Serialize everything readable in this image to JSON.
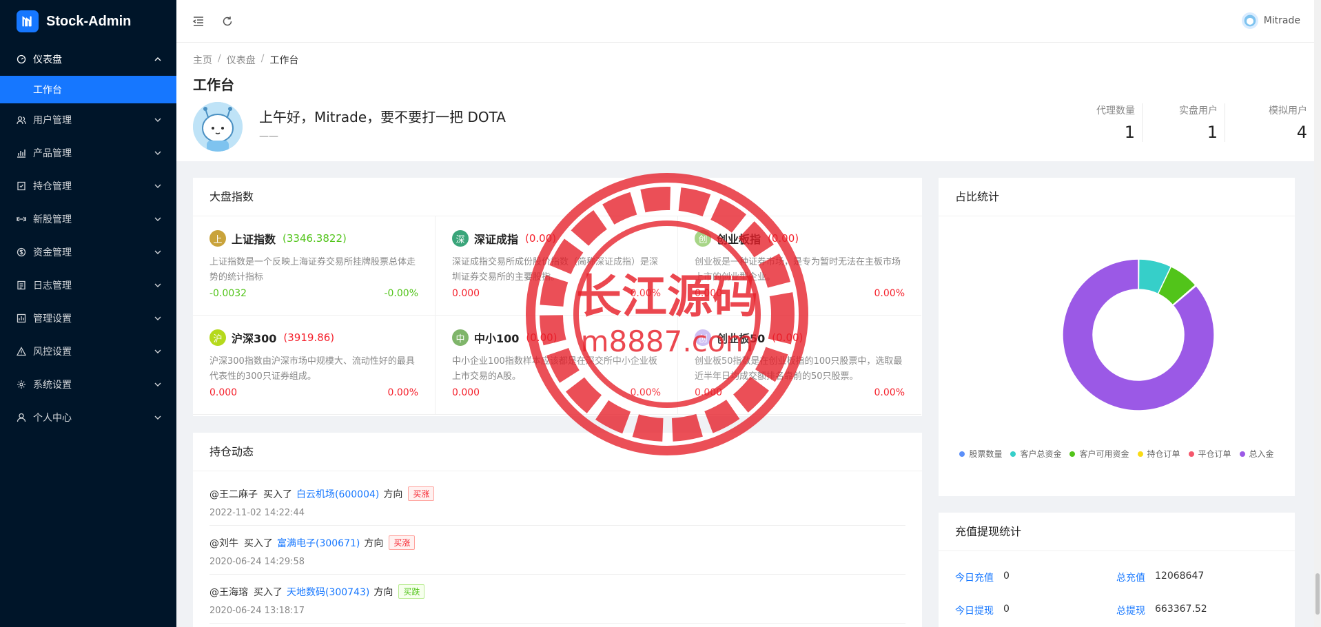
{
  "app": {
    "title": "Stock-Admin"
  },
  "sidebar": {
    "items": [
      {
        "label": "仪表盘",
        "icon": "dashboard-icon",
        "open": true,
        "children": [
          {
            "label": "工作台",
            "active": true
          }
        ]
      },
      {
        "label": "用户管理",
        "icon": "users-icon"
      },
      {
        "label": "产品管理",
        "icon": "chart-bar-icon"
      },
      {
        "label": "持仓管理",
        "icon": "position-icon"
      },
      {
        "label": "新股管理",
        "icon": "ipo-icon"
      },
      {
        "label": "资金管理",
        "icon": "dollar-icon"
      },
      {
        "label": "日志管理",
        "icon": "log-icon"
      },
      {
        "label": "管理设置",
        "icon": "settings-chart-icon"
      },
      {
        "label": "风控设置",
        "icon": "warning-icon"
      },
      {
        "label": "系统设置",
        "icon": "gear-icon"
      },
      {
        "label": "个人中心",
        "icon": "user-icon"
      }
    ]
  },
  "header": {
    "username": "Mitrade"
  },
  "breadcrumb": [
    "主页",
    "仪表盘",
    "工作台"
  ],
  "page": {
    "title": "工作台",
    "greeting": "上午好，Mitrade，要不要打一把 DOTA",
    "subtext": "——"
  },
  "stats": [
    {
      "label": "代理数量",
      "value": "1"
    },
    {
      "label": "实盘用户",
      "value": "1"
    },
    {
      "label": "模拟用户",
      "value": "4"
    }
  ],
  "market": {
    "title": "大盘指数",
    "indices": [
      {
        "badge": "上",
        "badge_color": "#c9a33b",
        "name": "上证指数",
        "value": "(3346.3822)",
        "trend": "up",
        "desc": "上证指数是一个反映上海证券交易所挂牌股票总体走势的统计指标",
        "change": "-0.0032",
        "percent": "-0.00%"
      },
      {
        "badge": "深",
        "badge_color": "#3aa57a",
        "name": "深证成指",
        "value": "(0.00)",
        "trend": "down",
        "desc": "深证成指交易所成份股价指数（简称深证成指）是深圳证券交易所的主要股指。",
        "change": "0.000",
        "percent": "0.00%"
      },
      {
        "badge": "创",
        "badge_color": "#9ed17a",
        "name": "创业板指",
        "value": "(0.00)",
        "trend": "down",
        "desc": "创业板是一种证券市场，是专为暂时无法在主板市场上市的创业型企业。",
        "change": "0.000",
        "percent": "0.00%"
      },
      {
        "badge": "沪",
        "badge_color": "#b5d91c",
        "name": "沪深300",
        "value": "(3919.86)",
        "trend": "down",
        "desc": "沪深300指数由沪深市场中规模大、流动性好的最具代表性的300只证券组成。",
        "change": "0.000",
        "percent": "0.00%"
      },
      {
        "badge": "中",
        "badge_color": "#7fb56a",
        "name": "中小100",
        "value": "(0.00)",
        "trend": "down",
        "desc": "中小企业100指数样本应该都是在深交所中小企业板上市交易的A股。",
        "change": "0.000",
        "percent": "0.00%"
      },
      {
        "badge": "创",
        "badge_color": "#c9b8f2",
        "name": "创业板50",
        "value": "(0.00)",
        "trend": "down",
        "desc": "创业板50指数是在创业板指的100只股票中，选取最近半年日均成交额排名靠前的50只股票。",
        "change": "0.000",
        "percent": "0.00%"
      }
    ]
  },
  "holdings": {
    "title": "持仓动态",
    "items": [
      {
        "user": "@王二麻子",
        "action": "买入了",
        "stock": "白云机场(600004)",
        "dir_label": "方向",
        "tag": "买涨",
        "tag_type": "red",
        "time": "2022-11-02 14:22:44"
      },
      {
        "user": "@刘牛",
        "action": "买入了",
        "stock": "富满电子(300671)",
        "dir_label": "方向",
        "tag": "买涨",
        "tag_type": "red",
        "time": "2020-06-24 14:29:58"
      },
      {
        "user": "@王海瑢",
        "action": "买入了",
        "stock": "天地数码(300743)",
        "dir_label": "方向",
        "tag": "买跌",
        "tag_type": "green",
        "time": "2020-06-24 13:18:17"
      }
    ]
  },
  "ratio": {
    "title": "占比统计",
    "legend": [
      {
        "label": "股票数量",
        "color": "#5b8ff9"
      },
      {
        "label": "客户总资金",
        "color": "#36cfc9"
      },
      {
        "label": "客户可用资金",
        "color": "#52c41a"
      },
      {
        "label": "持仓订单",
        "color": "#fadb14"
      },
      {
        "label": "平仓订单",
        "color": "#f5576c"
      },
      {
        "label": "总入金",
        "color": "#9b59e6"
      }
    ],
    "slices": [
      {
        "name": "股票数量",
        "value": 0.1
      },
      {
        "name": "客户总资金",
        "value": 7
      },
      {
        "name": "客户可用资金",
        "value": 6.5
      },
      {
        "name": "持仓订单",
        "value": 0.1
      },
      {
        "name": "平仓订单",
        "value": 0.1
      },
      {
        "name": "总入金",
        "value": 86.2
      }
    ]
  },
  "recharge": {
    "title": "充值提现统计",
    "rows": [
      [
        {
          "label": "今日充值",
          "value": "0"
        },
        {
          "label": "总充值",
          "value": "12068647"
        }
      ],
      [
        {
          "label": "今日提现",
          "value": "0"
        },
        {
          "label": "总提现",
          "value": "663367.52"
        }
      ]
    ]
  },
  "watermark": {
    "title": "长江源码",
    "url": "m8887.com"
  }
}
